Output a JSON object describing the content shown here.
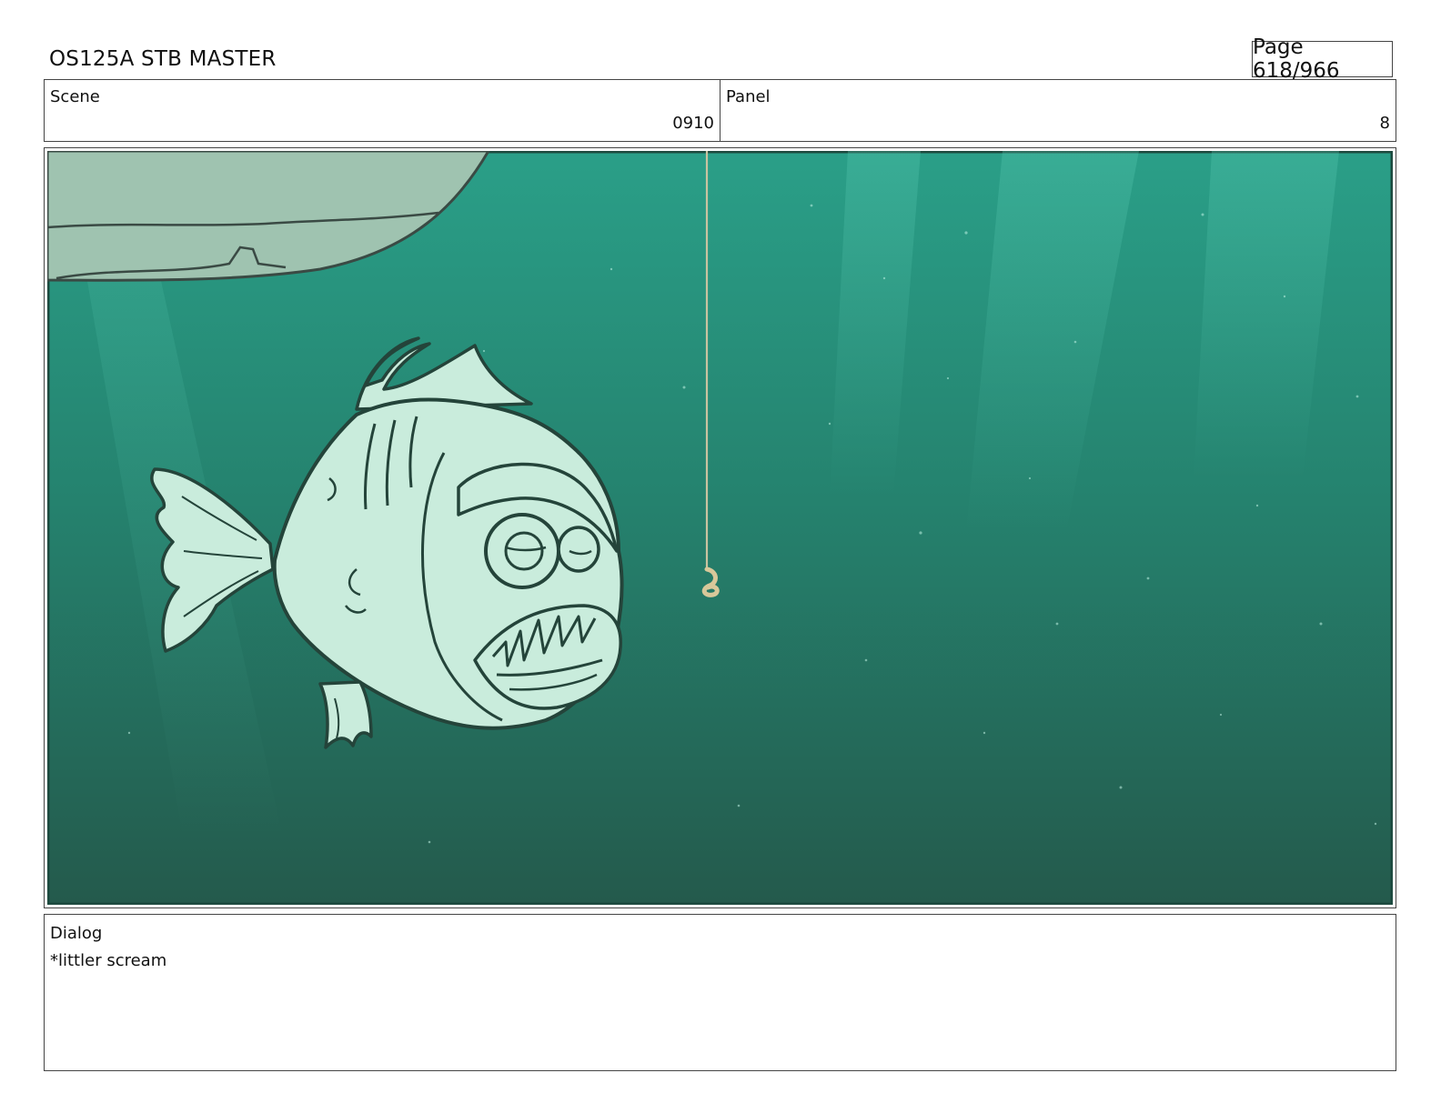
{
  "header": {
    "title": "OS125A STB MASTER",
    "page_label": "Page 618/966"
  },
  "scene": {
    "label": "Scene",
    "value": "0910"
  },
  "panel": {
    "label": "Panel",
    "value": "8"
  },
  "artwork": {
    "water_color": "#2c8a78",
    "fish_color": "#c9ecdc",
    "rock_color": "#9fc3b0",
    "fish": "piranha-like fish facing right",
    "hook": "fishing line with worm bait"
  },
  "dialog": {
    "label": "Dialog",
    "text": "*littler scream"
  }
}
